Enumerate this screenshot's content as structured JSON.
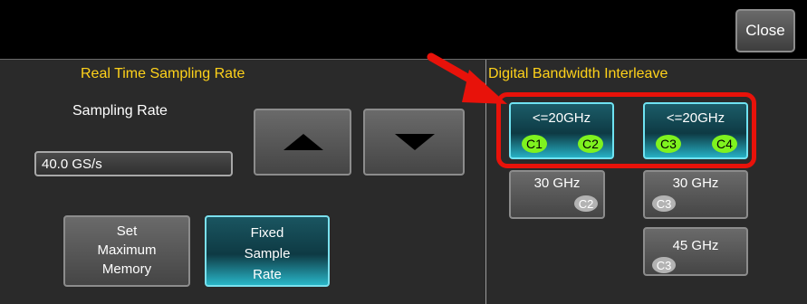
{
  "toolbar": {
    "close_label": "Close"
  },
  "left": {
    "heading": "Real Time Sampling Rate",
    "sampling_label": "Sampling Rate",
    "sampling_value": "40.0 GS/s",
    "set_memory_lines": [
      "Set",
      "Maximum",
      "Memory"
    ],
    "fixed_rate_lines": [
      "Fixed",
      "Sample",
      "Rate"
    ]
  },
  "right": {
    "heading": "Digital Bandwidth Interleave",
    "options": [
      {
        "label": "<=20GHz",
        "channels": [
          "C1",
          "C2"
        ],
        "selected": true
      },
      {
        "label": "<=20GHz",
        "channels": [
          "C3",
          "C4"
        ],
        "selected": true
      },
      {
        "label": "30 GHz",
        "channels": [
          "C2"
        ],
        "selected": false
      },
      {
        "label": "30 GHz",
        "channels": [
          "C3"
        ],
        "selected": false
      },
      {
        "label": "45 GHz",
        "channels": [
          "C3"
        ],
        "selected": false
      }
    ]
  },
  "colors": {
    "heading": "#ffd21a",
    "accent": "#26b0c4",
    "channel_active": "#7ff21f",
    "annotation": "#e8120a"
  },
  "icons": [
    "arrow-up-icon",
    "arrow-down-icon",
    "red-arrow-icon"
  ]
}
